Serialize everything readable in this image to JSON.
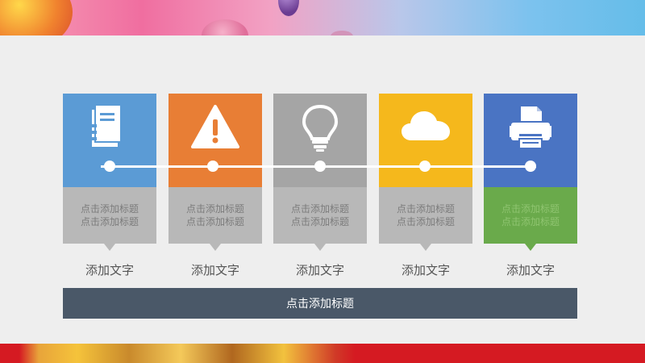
{
  "colors": {
    "blue": "#5b9bd5",
    "orange": "#e87e35",
    "gray": "#a5a5a5",
    "yellow": "#f5b81c",
    "navy_blue": "#4a74c3",
    "caption_gray": "#b8b8b8",
    "caption_green": "#6aaa4b",
    "title_bar": "#4a5868"
  },
  "panels": [
    {
      "icon": "document-icon",
      "caption_line1": "点击添加标题",
      "caption_line2": "点击添加标题",
      "label": "添加文字"
    },
    {
      "icon": "warning-icon",
      "caption_line1": "点击添加标题",
      "caption_line2": "点击添加标题",
      "label": "添加文字"
    },
    {
      "icon": "lightbulb-icon",
      "caption_line1": "点击添加标题",
      "caption_line2": "点击添加标题",
      "label": "添加文字"
    },
    {
      "icon": "cloud-icon",
      "caption_line1": "点击添加标题",
      "caption_line2": "点击添加标题",
      "label": "添加文字"
    },
    {
      "icon": "printer-icon",
      "caption_line1": "点击添加标题",
      "caption_line2": "点击添加标题",
      "label": "添加文字"
    }
  ],
  "title_bar": {
    "text": "点击添加标题"
  }
}
